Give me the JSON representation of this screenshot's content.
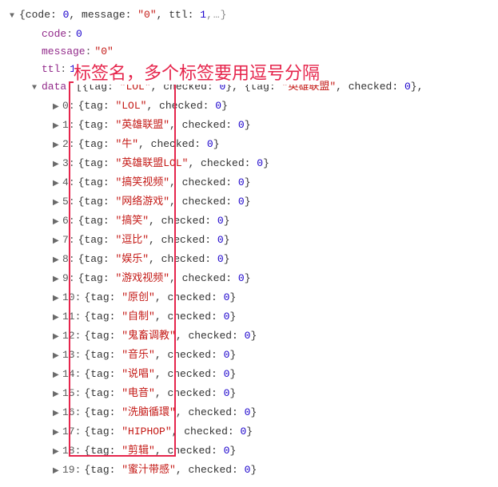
{
  "annotation": {
    "text": "标签名，多个标签要用逗号分隔"
  },
  "root": {
    "summary_prefix": "{code: ",
    "summary_code": "0",
    "summary_mid1": ", message: ",
    "summary_msg": "\"0\"",
    "summary_mid2": ", ttl: ",
    "summary_ttl": "1",
    "summary_suffix": ",…}"
  },
  "fields": {
    "code": {
      "key": "code",
      "val": "0"
    },
    "message": {
      "key": "message",
      "val": "\"0\""
    },
    "ttl": {
      "key": "ttl",
      "val": "1"
    },
    "data": {
      "key": "data"
    }
  },
  "data_preview": {
    "open": "[{tag: ",
    "t0": "\"LOL\"",
    "m0": ", checked: ",
    "c0": "0",
    "sep": "}, {tag: ",
    "t1": "\"英雄联盟\"",
    "m1": ", checked: ",
    "c1": "0",
    "end": "},"
  },
  "items": [
    {
      "idx": "0",
      "tag": "\"LOL\"",
      "checked": "0"
    },
    {
      "idx": "1",
      "tag": "\"英雄联盟\"",
      "checked": "0"
    },
    {
      "idx": "2",
      "tag": "\"牛\"",
      "checked": "0"
    },
    {
      "idx": "3",
      "tag": "\"英雄联盟LOL\"",
      "checked": "0"
    },
    {
      "idx": "4",
      "tag": "\"搞笑视频\"",
      "checked": "0"
    },
    {
      "idx": "5",
      "tag": "\"网络游戏\"",
      "checked": "0"
    },
    {
      "idx": "6",
      "tag": "\"搞笑\"",
      "checked": "0"
    },
    {
      "idx": "7",
      "tag": "\"逗比\"",
      "checked": "0"
    },
    {
      "idx": "8",
      "tag": "\"娱乐\"",
      "checked": "0"
    },
    {
      "idx": "9",
      "tag": "\"游戏视频\"",
      "checked": "0"
    },
    {
      "idx": "10",
      "tag": "\"原创\"",
      "checked": "0"
    },
    {
      "idx": "11",
      "tag": "\"自制\"",
      "checked": "0"
    },
    {
      "idx": "12",
      "tag": "\"鬼畜调教\"",
      "checked": "0"
    },
    {
      "idx": "13",
      "tag": "\"音乐\"",
      "checked": "0"
    },
    {
      "idx": "14",
      "tag": "\"说唱\"",
      "checked": "0"
    },
    {
      "idx": "15",
      "tag": "\"电音\"",
      "checked": "0"
    },
    {
      "idx": "16",
      "tag": "\"洗脑循環\"",
      "checked": "0"
    },
    {
      "idx": "17",
      "tag": "\"HIPHOP\"",
      "checked": "0"
    },
    {
      "idx": "18",
      "tag": "\"剪辑\"",
      "checked": "0"
    },
    {
      "idx": "19",
      "tag": "\"蜜汁带感\"",
      "checked": "0"
    }
  ],
  "labels": {
    "tag_key": "{tag: ",
    "checked_key": ", checked: ",
    "close": "}"
  }
}
